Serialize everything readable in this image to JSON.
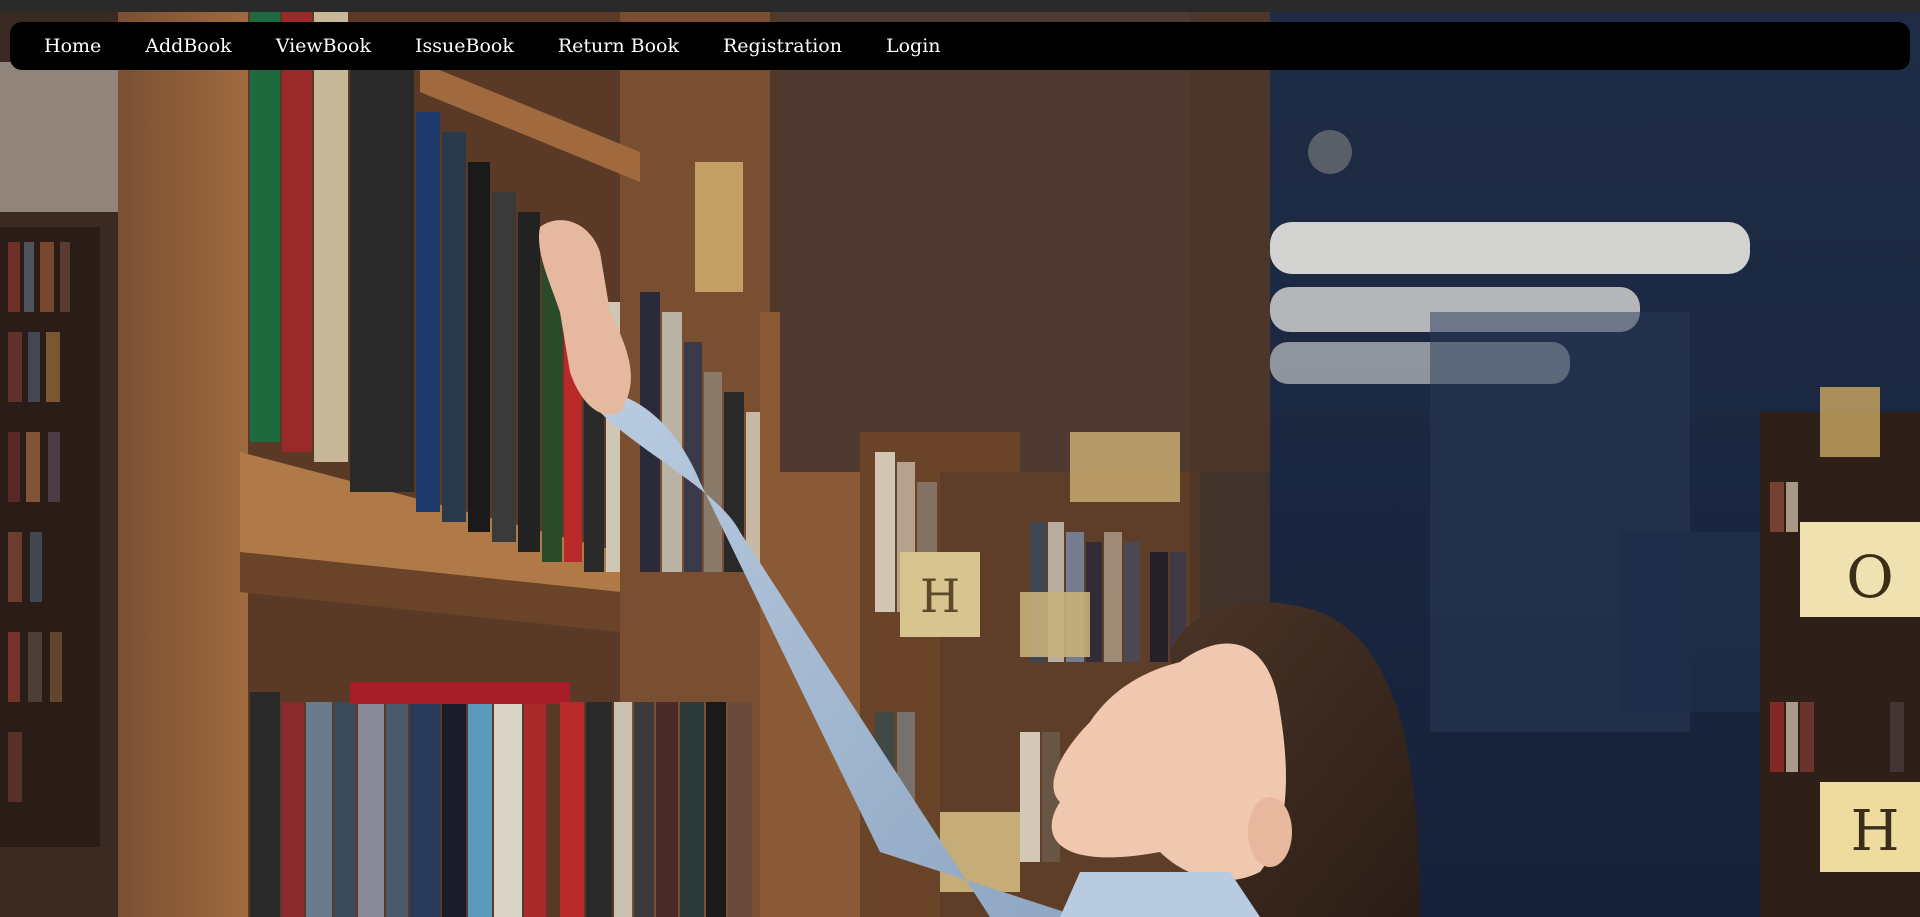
{
  "nav": {
    "items": [
      {
        "label": "Home"
      },
      {
        "label": "AddBook"
      },
      {
        "label": "ViewBook"
      },
      {
        "label": "IssueBook"
      },
      {
        "label": "Return Book"
      },
      {
        "label": "Registration"
      },
      {
        "label": "Login"
      }
    ]
  },
  "hero": {
    "image": "library-woman-reaching-bookshelf-photo",
    "shelf_signs": [
      "O",
      "H"
    ]
  },
  "colors": {
    "navbar_bg": "#000000",
    "nav_text": "#ffffff",
    "page_top_strip": "#2a2a2a"
  }
}
